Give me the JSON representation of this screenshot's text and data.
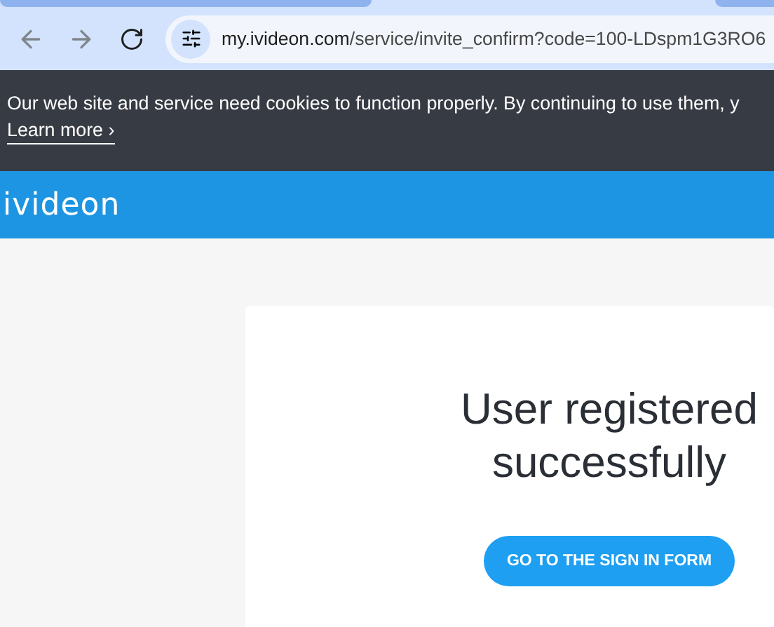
{
  "browser": {
    "url_host": "my.ivideon.com",
    "url_path": "/service/invite_confirm?code=100-LDspm1G3RO6"
  },
  "cookie_banner": {
    "text": "Our web site and service need cookies to function properly. By continuing to use them, y",
    "link": "Learn more ›"
  },
  "header": {
    "logo": "ivideon"
  },
  "card": {
    "title_lines": [
      "User registered",
      "successfully"
    ],
    "button": "GO TO THE SIGN IN FORM"
  }
}
